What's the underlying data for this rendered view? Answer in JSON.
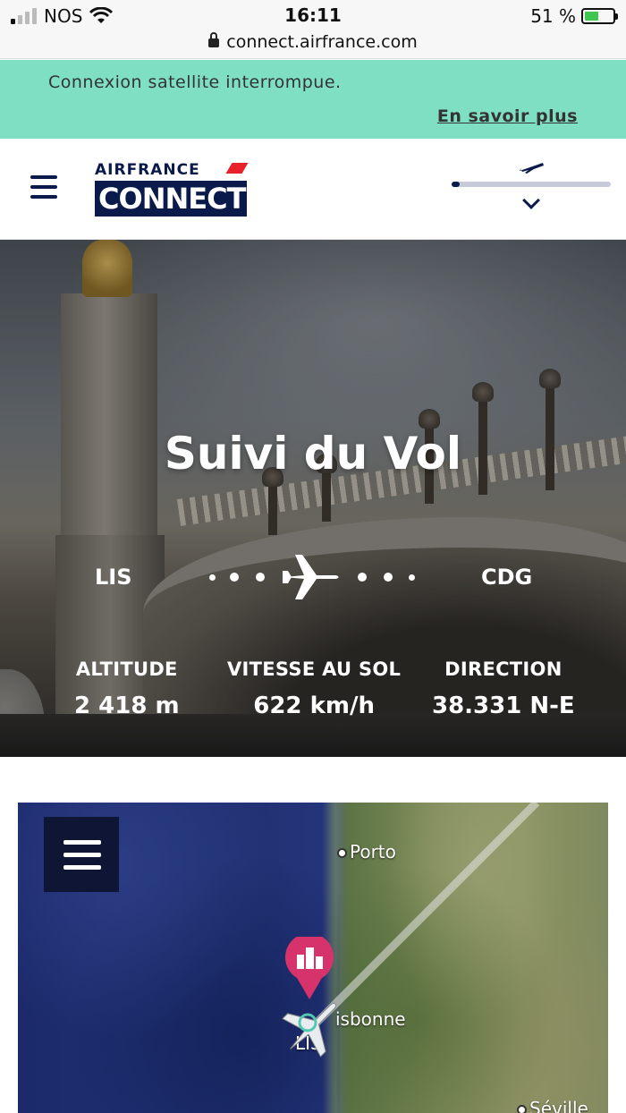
{
  "status_bar": {
    "carrier": "NOS",
    "time": "16:11",
    "battery": "51 %",
    "battery_level": 0.51
  },
  "browser": {
    "url": "connect.airfrance.com"
  },
  "banner": {
    "message": "Connexion satellite interrompue.",
    "link": "En savoir plus"
  },
  "header": {
    "logo_top": "AIRFRANCE",
    "logo_bottom": "CONNECT",
    "flight_progress": 0.05
  },
  "hero": {
    "title": "Suivi du Vol",
    "origin": "LIS",
    "destination": "CDG",
    "stats": [
      {
        "label": "ALTITUDE",
        "value": "2 418 m"
      },
      {
        "label": "VITESSE AU SOL",
        "value": "622 km/h"
      },
      {
        "label": "DIRECTION",
        "value": "38.331 N-E"
      }
    ]
  },
  "map": {
    "cities": {
      "porto": "Porto",
      "lisbon": "isbonne",
      "lis": "LIS",
      "seville": "Séville"
    },
    "colors": {
      "pin": "#d6336c",
      "sea": "#1f2f70",
      "land": "#7d8a58"
    }
  },
  "colors": {
    "banner": "#7fdfc3",
    "brand_navy": "#0a1a4a",
    "brand_red": "#e8202a"
  }
}
